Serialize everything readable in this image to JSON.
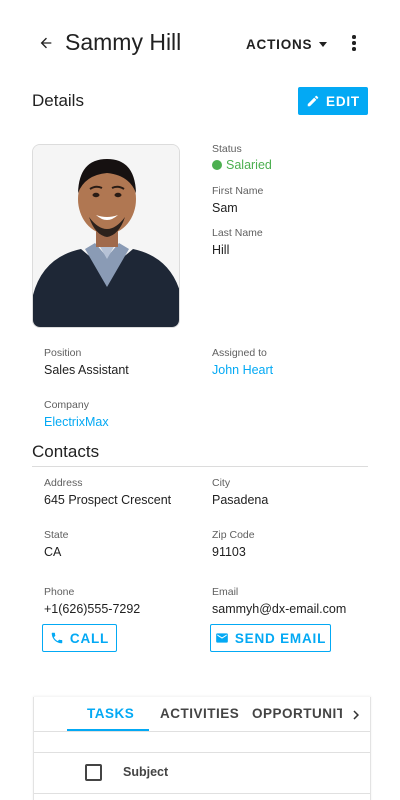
{
  "header": {
    "title": "Sammy Hill",
    "actions_label": "ACTIONS"
  },
  "details": {
    "section_title": "Details",
    "edit_label": "EDIT",
    "status": {
      "label": "Status",
      "value": "Salaried",
      "color": "#4caf50"
    },
    "first_name": {
      "label": "First Name",
      "value": "Sam"
    },
    "last_name": {
      "label": "Last Name",
      "value": "Hill"
    },
    "position": {
      "label": "Position",
      "value": "Sales Assistant"
    },
    "assigned_to": {
      "label": "Assigned to",
      "value": "John Heart"
    },
    "company": {
      "label": "Company",
      "value": "ElectrixMax"
    }
  },
  "contacts": {
    "section_title": "Contacts",
    "address": {
      "label": "Address",
      "value": "645 Prospect Crescent"
    },
    "city": {
      "label": "City",
      "value": "Pasadena"
    },
    "state": {
      "label": "State",
      "value": "CA"
    },
    "zip": {
      "label": "Zip Code",
      "value": "91103"
    },
    "phone": {
      "label": "Phone",
      "value": "+1(626)555-7292"
    },
    "email": {
      "label": "Email",
      "value": "sammyh@dx-email.com"
    },
    "call_label": "CALL",
    "send_email_label": "SEND EMAIL"
  },
  "tabs": {
    "items": [
      {
        "label": "TASKS",
        "active": true
      },
      {
        "label": "ACTIVITIES",
        "active": false
      },
      {
        "label": "OPPORTUNITIES",
        "active": false
      }
    ],
    "grid": {
      "subject_header": "Subject"
    }
  },
  "theme": {
    "accent": "#03a9f4",
    "text": "#212121",
    "muted": "#5f5f5f",
    "border": "#dcdcdc"
  },
  "icons": [
    "arrow-left-icon",
    "caret-down-icon",
    "more-vertical-icon",
    "pencil-icon",
    "phone-icon",
    "mail-icon",
    "chevron-right-icon"
  ]
}
